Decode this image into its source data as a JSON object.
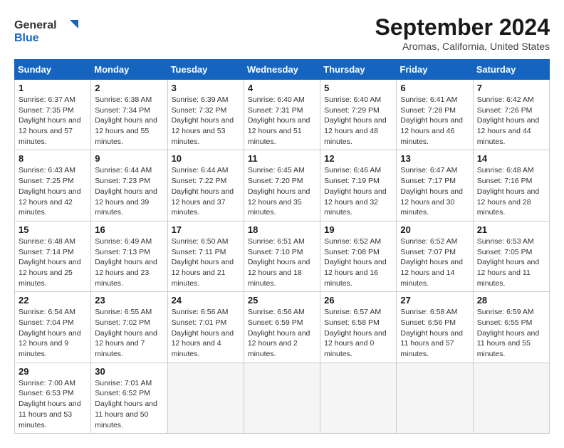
{
  "header": {
    "logo_general": "General",
    "logo_blue": "Blue",
    "title": "September 2024",
    "subtitle": "Aromas, California, United States"
  },
  "calendar": {
    "columns": [
      "Sunday",
      "Monday",
      "Tuesday",
      "Wednesday",
      "Thursday",
      "Friday",
      "Saturday"
    ],
    "weeks": [
      [
        null,
        null,
        null,
        null,
        null,
        null,
        null
      ]
    ],
    "days": [
      {
        "day": "1",
        "sunrise": "6:37 AM",
        "sunset": "7:35 PM",
        "daylight": "12 hours and 57 minutes."
      },
      {
        "day": "2",
        "sunrise": "6:38 AM",
        "sunset": "7:34 PM",
        "daylight": "12 hours and 55 minutes."
      },
      {
        "day": "3",
        "sunrise": "6:39 AM",
        "sunset": "7:32 PM",
        "daylight": "12 hours and 53 minutes."
      },
      {
        "day": "4",
        "sunrise": "6:40 AM",
        "sunset": "7:31 PM",
        "daylight": "12 hours and 51 minutes."
      },
      {
        "day": "5",
        "sunrise": "6:40 AM",
        "sunset": "7:29 PM",
        "daylight": "12 hours and 48 minutes."
      },
      {
        "day": "6",
        "sunrise": "6:41 AM",
        "sunset": "7:28 PM",
        "daylight": "12 hours and 46 minutes."
      },
      {
        "day": "7",
        "sunrise": "6:42 AM",
        "sunset": "7:26 PM",
        "daylight": "12 hours and 44 minutes."
      },
      {
        "day": "8",
        "sunrise": "6:43 AM",
        "sunset": "7:25 PM",
        "daylight": "12 hours and 42 minutes."
      },
      {
        "day": "9",
        "sunrise": "6:44 AM",
        "sunset": "7:23 PM",
        "daylight": "12 hours and 39 minutes."
      },
      {
        "day": "10",
        "sunrise": "6:44 AM",
        "sunset": "7:22 PM",
        "daylight": "12 hours and 37 minutes."
      },
      {
        "day": "11",
        "sunrise": "6:45 AM",
        "sunset": "7:20 PM",
        "daylight": "12 hours and 35 minutes."
      },
      {
        "day": "12",
        "sunrise": "6:46 AM",
        "sunset": "7:19 PM",
        "daylight": "12 hours and 32 minutes."
      },
      {
        "day": "13",
        "sunrise": "6:47 AM",
        "sunset": "7:17 PM",
        "daylight": "12 hours and 30 minutes."
      },
      {
        "day": "14",
        "sunrise": "6:48 AM",
        "sunset": "7:16 PM",
        "daylight": "12 hours and 28 minutes."
      },
      {
        "day": "15",
        "sunrise": "6:48 AM",
        "sunset": "7:14 PM",
        "daylight": "12 hours and 25 minutes."
      },
      {
        "day": "16",
        "sunrise": "6:49 AM",
        "sunset": "7:13 PM",
        "daylight": "12 hours and 23 minutes."
      },
      {
        "day": "17",
        "sunrise": "6:50 AM",
        "sunset": "7:11 PM",
        "daylight": "12 hours and 21 minutes."
      },
      {
        "day": "18",
        "sunrise": "6:51 AM",
        "sunset": "7:10 PM",
        "daylight": "12 hours and 18 minutes."
      },
      {
        "day": "19",
        "sunrise": "6:52 AM",
        "sunset": "7:08 PM",
        "daylight": "12 hours and 16 minutes."
      },
      {
        "day": "20",
        "sunrise": "6:52 AM",
        "sunset": "7:07 PM",
        "daylight": "12 hours and 14 minutes."
      },
      {
        "day": "21",
        "sunrise": "6:53 AM",
        "sunset": "7:05 PM",
        "daylight": "12 hours and 11 minutes."
      },
      {
        "day": "22",
        "sunrise": "6:54 AM",
        "sunset": "7:04 PM",
        "daylight": "12 hours and 9 minutes."
      },
      {
        "day": "23",
        "sunrise": "6:55 AM",
        "sunset": "7:02 PM",
        "daylight": "12 hours and 7 minutes."
      },
      {
        "day": "24",
        "sunrise": "6:56 AM",
        "sunset": "7:01 PM",
        "daylight": "12 hours and 4 minutes."
      },
      {
        "day": "25",
        "sunrise": "6:56 AM",
        "sunset": "6:59 PM",
        "daylight": "12 hours and 2 minutes."
      },
      {
        "day": "26",
        "sunrise": "6:57 AM",
        "sunset": "6:58 PM",
        "daylight": "12 hours and 0 minutes."
      },
      {
        "day": "27",
        "sunrise": "6:58 AM",
        "sunset": "6:56 PM",
        "daylight": "11 hours and 57 minutes."
      },
      {
        "day": "28",
        "sunrise": "6:59 AM",
        "sunset": "6:55 PM",
        "daylight": "11 hours and 55 minutes."
      },
      {
        "day": "29",
        "sunrise": "7:00 AM",
        "sunset": "6:53 PM",
        "daylight": "11 hours and 53 minutes."
      },
      {
        "day": "30",
        "sunrise": "7:01 AM",
        "sunset": "6:52 PM",
        "daylight": "11 hours and 50 minutes."
      }
    ]
  }
}
